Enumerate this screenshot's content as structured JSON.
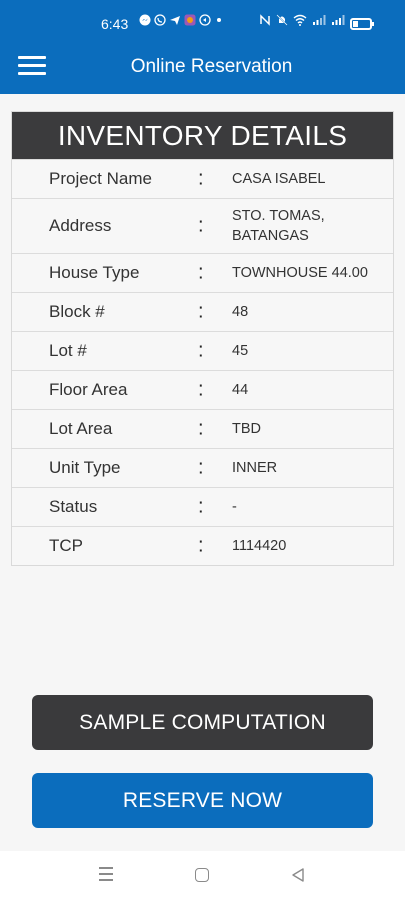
{
  "status_bar": {
    "time": "6:43"
  },
  "app_bar": {
    "title": "Online Reservation"
  },
  "inventory": {
    "heading": "INVENTORY DETAILS",
    "rows": [
      {
        "label": "Project Name",
        "colon": ":",
        "value": "CASA ISABEL"
      },
      {
        "label": "Address",
        "colon": ":",
        "value_line1": "STO. TOMAS,",
        "value_line2": "BATANGAS"
      },
      {
        "label": "House Type",
        "colon": ":",
        "value": "TOWNHOUSE 44.00"
      },
      {
        "label": "Block #",
        "colon": ":",
        "value": "48"
      },
      {
        "label": "Lot #",
        "colon": ":",
        "value": "45"
      },
      {
        "label": "Floor Area",
        "colon": ":",
        "value": "44"
      },
      {
        "label": "Lot Area",
        "colon": ":",
        "value": "TBD"
      },
      {
        "label": "Unit Type",
        "colon": ":",
        "value": "INNER"
      },
      {
        "label": "Status",
        "colon": ":",
        "value": "-"
      },
      {
        "label": "TCP",
        "colon": ":",
        "value": "1114420"
      }
    ]
  },
  "actions": {
    "sample_label": "SAMPLE COMPUTATION",
    "reserve_label": "RESERVE NOW"
  },
  "colors": {
    "primary": "#0b6dbd",
    "dark": "#3a3a3c"
  }
}
